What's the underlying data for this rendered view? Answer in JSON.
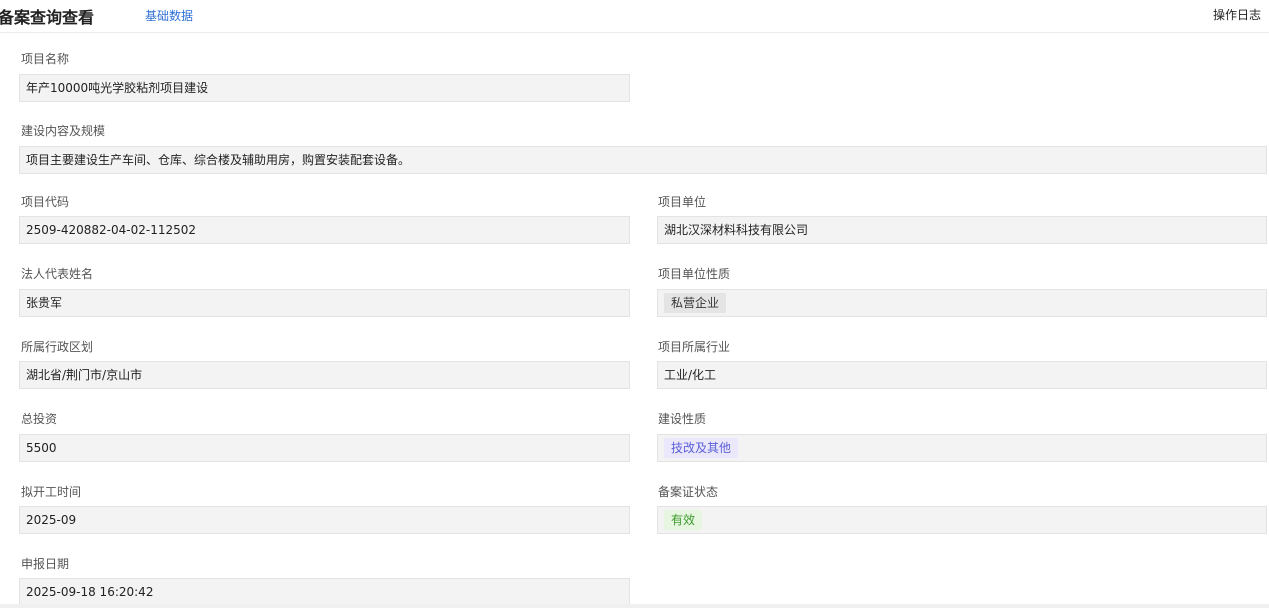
{
  "header": {
    "title": "备案查询查看",
    "tab_label": "基础数据",
    "log_label": "操作日志"
  },
  "fields": {
    "project_name": {
      "label": "项目名称",
      "value": "年产10000吨光学胶粘剂项目建设"
    },
    "content_scale": {
      "label": "建设内容及规模",
      "value": "项目主要建设生产车间、仓库、综合楼及辅助用房，购置安装配套设备。"
    },
    "project_code": {
      "label": "项目代码",
      "value": "2509-420882-04-02-112502"
    },
    "project_unit": {
      "label": "项目单位",
      "value": "湖北汉深材料科技有限公司"
    },
    "legal_rep": {
      "label": "法人代表姓名",
      "value": "张贵军"
    },
    "unit_nature": {
      "label": "项目单位性质",
      "value": "私营企业"
    },
    "region": {
      "label": "所属行政区划",
      "value": "湖北省/荆门市/京山市"
    },
    "industry": {
      "label": "项目所属行业",
      "value": "工业/化工"
    },
    "total_investment": {
      "label": "总投资",
      "value": "5500"
    },
    "build_nature": {
      "label": "建设性质",
      "value": "技改及其他"
    },
    "start_time": {
      "label": "拟开工时间",
      "value": "2025-09"
    },
    "cert_status": {
      "label": "备案证状态",
      "value": "有效"
    },
    "apply_date": {
      "label": "申报日期",
      "value": "2025-09-18 16:20:42"
    }
  },
  "colors": {
    "tab_link": "#2f6fd6",
    "tag_purple": "#5b5fd6",
    "tag_green": "#3c9a2c"
  }
}
